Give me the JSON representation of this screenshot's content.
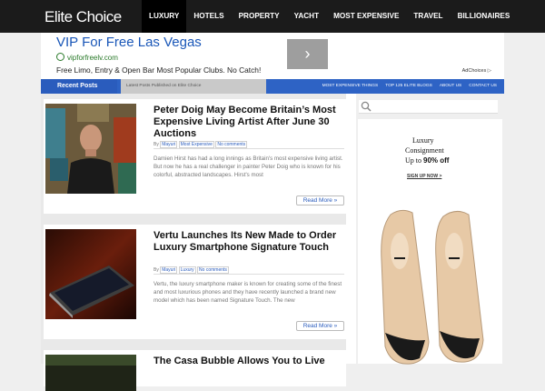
{
  "brand": {
    "logo_text": "Elite Choice"
  },
  "nav": {
    "items": [
      "LUXURY",
      "HOTELS",
      "PROPERTY",
      "YACHT",
      "MOST EXPENSIVE",
      "TRAVEL",
      "BILLIONAIRES"
    ]
  },
  "ad": {
    "title": "VIP For Free Las Vegas",
    "url": "vipforfreelv.com",
    "description": "Free Limo, Entry & Open Bar Most Popular Clubs. No Catch!",
    "adchoices": "AdChoices"
  },
  "section": {
    "recent_label": "Recent Posts",
    "subtitle": "Latest Posts Published on Elite Choice",
    "links": [
      "MOST EXPENSIVE THINGS",
      "TOP 125 ELITE BLOGS",
      "ABOUT US",
      "CONTACT US"
    ]
  },
  "posts": [
    {
      "title": "Peter Doig May Become Britain’s Most Expensive Living Artist After June 30 Auctions",
      "by": "By",
      "author": "Mayuri",
      "category": "Most Expensive",
      "comments": "No comments",
      "excerpt": "Damien Hirst has had a long innings as Britain's most expensive living artist. But now he has a real challenger in painter Peter Doig who is known for his colorful, abstracted landscapes. Hirst's most",
      "readmore": "Read More »"
    },
    {
      "title": "Vertu Launches Its New Made to Order Luxury Smartphone Signature Touch",
      "by": "By",
      "author": "Mayuri",
      "category": "Luxury",
      "comments": "No comments",
      "excerpt": "Vertu, the luxury smartphone maker is known for creating some of the finest and most luxurious phones and they have recently launched a brand new model which has been named Signature Touch. The new",
      "readmore": "Read More »"
    },
    {
      "title": "The Casa Bubble Allows You to Live"
    }
  ],
  "sidebar": {
    "ad_line1": "Luxury",
    "ad_line2": "Consignment",
    "ad_line3_prefix": "Up to",
    "ad_line3_value": "90% off",
    "ad_signup": "SIGN UP NOW >"
  },
  "colors": {
    "topbar": "#1b1b1b",
    "accent": "#2e63c5",
    "ad_link": "#1a57b8"
  }
}
